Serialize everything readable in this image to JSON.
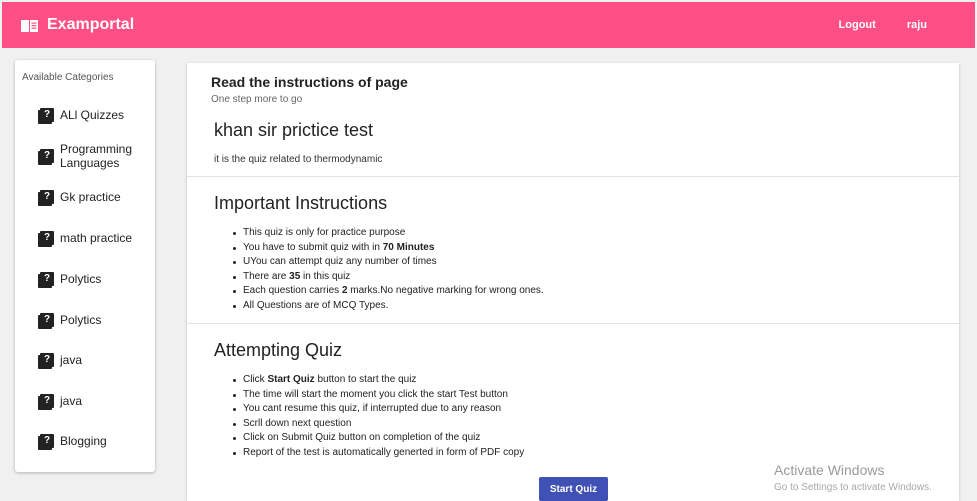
{
  "header": {
    "brand": "Examportal",
    "logout": "Logout",
    "user": "raju"
  },
  "sidebar": {
    "title": "Available Categories",
    "items": [
      {
        "label": "ALl Quizzes"
      },
      {
        "label": "Programming Languages"
      },
      {
        "label": "Gk practice"
      },
      {
        "label": "math practice"
      },
      {
        "label": "Polytics"
      },
      {
        "label": "Polytics"
      },
      {
        "label": "java"
      },
      {
        "label": "java"
      },
      {
        "label": "Blogging"
      }
    ]
  },
  "main": {
    "heading": "Read the instructions of page",
    "subheading": "One step more to go",
    "quiz_title": "khan sir prictice test",
    "quiz_description": "it is the quiz related to thermodynamic",
    "important": {
      "title": "Important Instructions",
      "items": [
        {
          "text": "This quiz is only for practice purpose"
        },
        {
          "pre": "You have to submit quiz with in ",
          "bold": "70 Minutes",
          "post": ""
        },
        {
          "text": "UYou can attempt quiz any number of times"
        },
        {
          "pre": "There are ",
          "bold": "35",
          "post": " in this quiz"
        },
        {
          "pre": "Each question carries ",
          "bold": "2",
          "post": " marks.No negative marking for wrong ones."
        },
        {
          "text": "All Questions are of MCQ Types."
        }
      ]
    },
    "attempting": {
      "title": "Attempting Quiz",
      "items": [
        {
          "pre": "Click ",
          "bold": "Start Quiz",
          "post": " button to start the quiz"
        },
        {
          "text": "The time will start the moment you click the start Test button"
        },
        {
          "text": "You cant resume this quiz, if interrupted due to any reason"
        },
        {
          "text": "Scrll down next question"
        },
        {
          "text": "Click on Submit Quiz button on completion of the quiz"
        },
        {
          "text": "Report of the test is automatically generted in form of PDF copy"
        }
      ]
    },
    "start_button": "Start Quiz"
  },
  "watermark": {
    "title": "Activate Windows",
    "subtitle": "Go to Settings to activate Windows."
  }
}
